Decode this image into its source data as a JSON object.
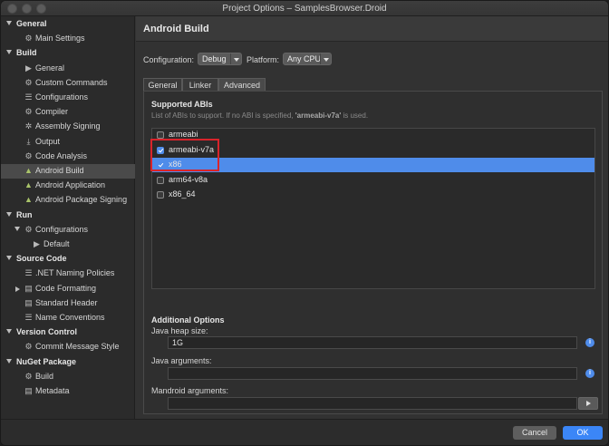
{
  "window": {
    "title": "Project Options – SamplesBrowser.Droid"
  },
  "sidebar": {
    "rows": [
      {
        "kind": "head",
        "label": "General",
        "expanded": true
      },
      {
        "kind": "item",
        "label": "Main Settings",
        "icon": "gear-icon"
      },
      {
        "kind": "head",
        "label": "Build",
        "expanded": true
      },
      {
        "kind": "item",
        "label": "General",
        "icon": "play-icon"
      },
      {
        "kind": "item",
        "label": "Custom Commands",
        "icon": "gear-icon"
      },
      {
        "kind": "item",
        "label": "Configurations",
        "icon": "list-icon"
      },
      {
        "kind": "item",
        "label": "Compiler",
        "icon": "gear-icon"
      },
      {
        "kind": "item",
        "label": "Assembly Signing",
        "icon": "key-icon"
      },
      {
        "kind": "item",
        "label": "Output",
        "icon": "download-icon"
      },
      {
        "kind": "item",
        "label": "Code Analysis",
        "icon": "gear-icon"
      },
      {
        "kind": "item",
        "label": "Android Build",
        "icon": "android-icon",
        "selected": true
      },
      {
        "kind": "item",
        "label": "Android Application",
        "icon": "android-icon"
      },
      {
        "kind": "item",
        "label": "Android Package Signing",
        "icon": "android-icon"
      },
      {
        "kind": "head",
        "label": "Run",
        "expanded": true
      },
      {
        "kind": "subhead",
        "label": "Configurations",
        "icon": "gear-icon"
      },
      {
        "kind": "subitem",
        "label": "Default",
        "icon": "play-icon"
      },
      {
        "kind": "head",
        "label": "Source Code",
        "expanded": true
      },
      {
        "kind": "item",
        "label": ".NET Naming Policies",
        "icon": "list-icon"
      },
      {
        "kind": "subhead2",
        "label": "Code Formatting",
        "icon": "document-icon"
      },
      {
        "kind": "item",
        "label": "Standard Header",
        "icon": "document-icon"
      },
      {
        "kind": "item",
        "label": "Name Conventions",
        "icon": "list-icon"
      },
      {
        "kind": "head",
        "label": "Version Control",
        "expanded": true
      },
      {
        "kind": "item",
        "label": "Commit Message Style",
        "icon": "gear-icon"
      },
      {
        "kind": "head",
        "label": "NuGet Package",
        "expanded": true
      },
      {
        "kind": "item",
        "label": "Build",
        "icon": "gear-icon"
      },
      {
        "kind": "item",
        "label": "Metadata",
        "icon": "document-icon"
      }
    ]
  },
  "main": {
    "title": "Android Build",
    "configuration_label": "Configuration:",
    "configuration_value": "Debug",
    "platform_label": "Platform:",
    "platform_value": "Any CPU",
    "tabs": [
      {
        "label": "General"
      },
      {
        "label": "Linker"
      },
      {
        "label": "Advanced",
        "active": true
      }
    ],
    "abis": {
      "heading": "Supported ABIs",
      "hint_prefix": "List of ABIs to support. If no ABI is specified, ",
      "hint_bold": "'armeabi-v7a'",
      "hint_suffix": " is used.",
      "items": [
        {
          "label": "armeabi",
          "checked": false
        },
        {
          "label": "armeabi-v7a",
          "checked": true
        },
        {
          "label": "x86",
          "checked": true,
          "selected": true
        },
        {
          "label": "arm64-v8a",
          "checked": false
        },
        {
          "label": "x86_64",
          "checked": false
        }
      ]
    },
    "additional": {
      "heading": "Additional Options",
      "heap_label": "Java heap size:",
      "heap_value": "1G",
      "java_args_label": "Java arguments:",
      "java_args_value": "",
      "mandroid_label": "Mandroid arguments:",
      "mandroid_value": ""
    }
  },
  "footer": {
    "cancel_label": "Cancel",
    "ok_label": "OK"
  },
  "colors": {
    "accent": "#4f8cea",
    "ok_button": "#3b86f7",
    "highlight": "#d9242b"
  }
}
